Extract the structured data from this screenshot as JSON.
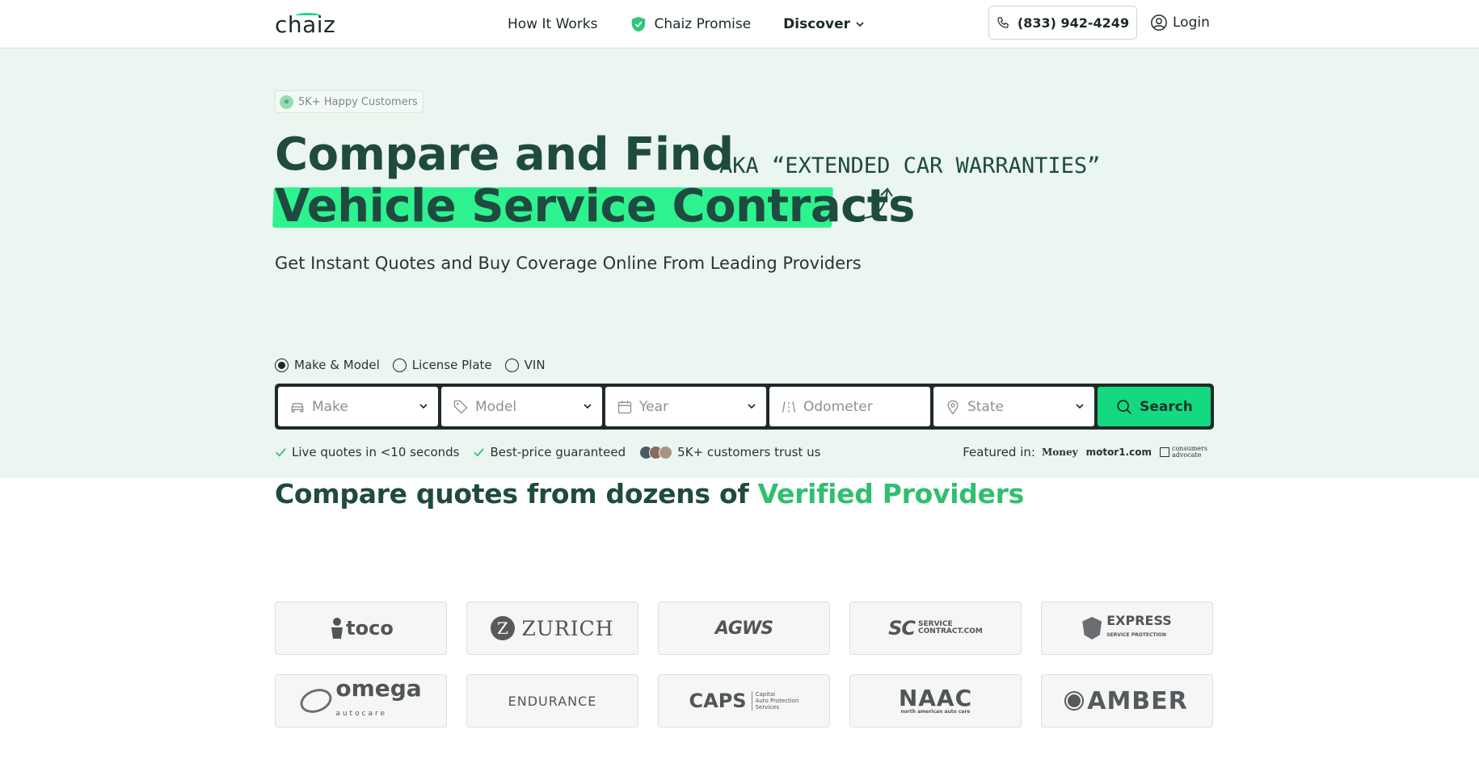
{
  "header": {
    "logo": "chaiz",
    "nav": [
      {
        "label": "How It Works"
      },
      {
        "label": "Chaiz Promise"
      },
      {
        "label": "Discover"
      }
    ],
    "phone": "(833) 942-4249",
    "login": "Login"
  },
  "hero": {
    "badge": "5K+ Happy Customers",
    "title_line1": "Compare and Find",
    "title_line2": "Vehicle Service Contracts",
    "aka": "AKA “EXTENDED CAR WARRANTIES”",
    "subtitle": "Get Instant Quotes and Buy Coverage Online From Leading Providers",
    "search_modes": [
      "Make & Model",
      "License Plate",
      "VIN"
    ],
    "selected_mode": "Make & Model",
    "fields": {
      "make": "Make",
      "model": "Model",
      "year": "Year",
      "odometer": "Odometer",
      "state": "State"
    },
    "search_label": "Search",
    "perks": [
      "Live quotes in <10 seconds",
      "Best-price guaranteed",
      "5K+ customers trust us"
    ],
    "featured_label": "Featured in:",
    "featured": [
      "Money",
      "motor1.com",
      "consumers advocate"
    ]
  },
  "providers": {
    "title_prefix": "Compare quotes from dozens of ",
    "title_highlight": "Verified Providers",
    "logos": {
      "toco": "toco",
      "zurich": "ZURICH",
      "agws": "AGWS",
      "sc_big": "SC",
      "sc_line1": "SERVICE",
      "sc_line2": "CONTRACT.COM",
      "express": "EXPRESS",
      "express_tag": "SERVICE PROTECTION",
      "omega": "omega",
      "omega_sub": "autocare",
      "endurance": "ENDURANCE",
      "caps": "CAPS",
      "caps_t1": "Capital",
      "caps_t2": "Auto Protection",
      "caps_t3": "Services",
      "naac": "NAAC",
      "naac_sub": "north american auto care",
      "amber": "AMBER"
    }
  },
  "colors": {
    "accent": "#14d981",
    "hero_bg": "#eaf6ef",
    "heading": "#1f4a40",
    "highlight": "#2fbf6f"
  }
}
